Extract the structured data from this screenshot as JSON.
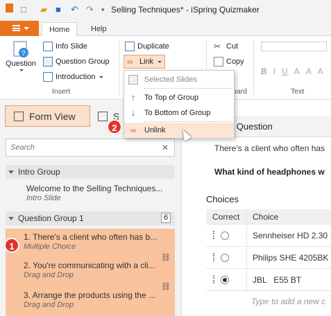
{
  "window": {
    "title": "Selling Techniques* - iSpring Quizmaker"
  },
  "tabs": {
    "home": "Home",
    "help": "Help"
  },
  "ribbon": {
    "question": "Question",
    "info_slide": "Info Slide",
    "question_group": "Question Group",
    "introduction": "Introduction",
    "insert_label": "Insert",
    "duplicate": "Duplicate",
    "link": "Link",
    "cut": "Cut",
    "copy": "Copy",
    "board_label": "oard",
    "text_label": "Text",
    "format_buttons": [
      "B",
      "I",
      "U",
      "A",
      "A",
      "A"
    ]
  },
  "dropdown": {
    "selected_slides": "Selected Slides",
    "to_top": "To Top of Group",
    "to_bottom": "To Bottom of Group",
    "unlink": "Unlink"
  },
  "left_panel": {
    "form_view": "Form View",
    "slide_view": "S",
    "search_placeholder": "Search",
    "intro_group": "Intro Group",
    "intro_item_title": "Welcome to the Selling Techniques...",
    "intro_item_sub": "Intro Slide",
    "question_group": "Question Group 1",
    "question_group_count": "6",
    "items": [
      {
        "title": "1. There's a client who often has b...",
        "sub": "Multiple Choice"
      },
      {
        "title": "2. You're communicating with a cli...",
        "sub": "Drag and Drop"
      },
      {
        "title": "3. Arrange the products using the ...",
        "sub": "Drag and Drop"
      }
    ]
  },
  "editor": {
    "header": "le Choice Question",
    "question_text": "There's a client who often has",
    "prompt_text": "What kind of headphones w",
    "choices_label": "Choices",
    "col_correct": "Correct",
    "col_choice": "Choice",
    "choices": [
      {
        "text": "Sennheiser HD 2.30",
        "selected": false
      },
      {
        "text": "Philips SHE 4205BK",
        "selected": false
      },
      {
        "text": "JBL   E55 BT",
        "selected": true
      }
    ],
    "add_choice": "Type to add a new c"
  },
  "markers": {
    "one": "1",
    "two": "2"
  },
  "colors": {
    "accent": "#e8731c",
    "selection": "#f9c39e",
    "marker": "#e0352f"
  }
}
